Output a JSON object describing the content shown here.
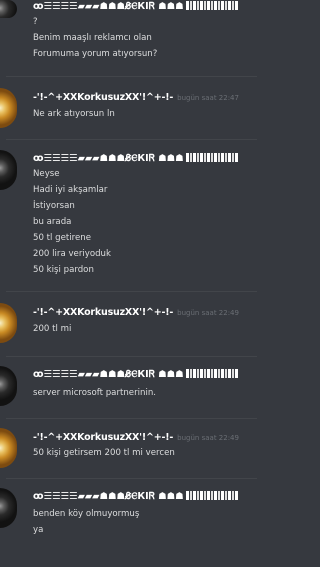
{
  "user_a": "ꝏ☰☰☰☰▰▰▰☗☗☗Ᏸ̷ⲈКІᏒ ☗☗☗",
  "user_b": "-'!-^+XXKorkusuzXX'!^+-!-",
  "timestamp": "bugün saat 22:47",
  "timestamp_2": "bugün saat 22:49",
  "messages": [
    {
      "lines": [
        "?",
        "Benim maaşlı reklamcı olan",
        "Forumuma yorum atıyorsun?"
      ]
    },
    {
      "lines": [
        "Ne ark atıyorsun ln"
      ]
    },
    {
      "lines": [
        "Neyse",
        "Hadi iyi akşamlar",
        "İstiyorsan",
        "bu arada",
        "50 tl getirene",
        "200 lira veriyoduk",
        "50 kişi pardon"
      ]
    },
    {
      "lines": [
        "200 tl mi"
      ]
    },
    {
      "lines": [
        "server microsoft partnerinin."
      ]
    },
    {
      "lines": [
        "50 kişi getirsem 200 tl mi vercen"
      ]
    },
    {
      "lines": [
        "benden köy olmuyormuş",
        "ya"
      ]
    }
  ]
}
